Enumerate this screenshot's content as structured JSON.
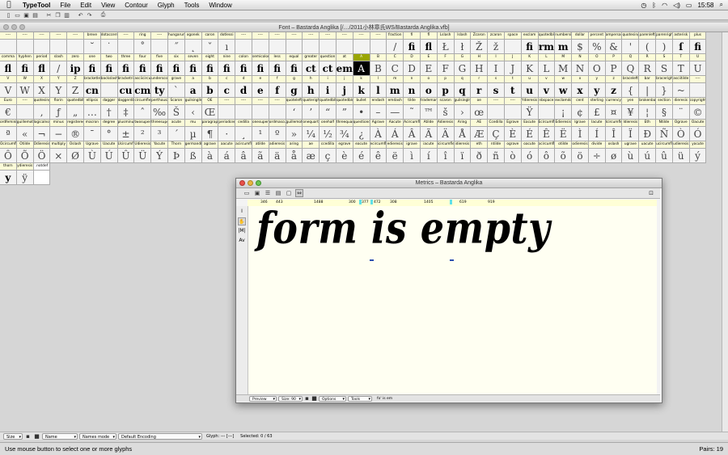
{
  "menubar": {
    "app_name": "TypeTool",
    "items": [
      "File",
      "Edit",
      "View",
      "Contour",
      "Glyph",
      "Tools",
      "Window"
    ],
    "clock": "15:58"
  },
  "font_window": {
    "title": "Font – Bastarda Anglika [/…/2011小林章氏WS/Bastarda Anglika.vfb]",
    "rows": [
      {
        "labels": [
          "----",
          "----",
          "----",
          "----",
          "----",
          "breve",
          "dotaccent",
          "----",
          "ring",
          "----",
          "hungarumlaut",
          "ogonek",
          "caron",
          "dotlessi",
          "----",
          "----",
          "----",
          "----",
          "----",
          "----",
          "----",
          "----",
          "----",
          "fraction",
          "fi",
          "fl",
          "Lslash",
          "lslash",
          "Zcaron",
          "zcaron",
          "space",
          "exclam",
          "quotedbl",
          "numbersign",
          "dollar",
          "percent",
          "ampersand",
          "quotesingle",
          "parenleft",
          "parenright",
          "asterisk",
          "plus"
        ],
        "glyphs": [
          "",
          "",
          "",
          "",
          "",
          "˘",
          "˙",
          "",
          "˚",
          "",
          "˝",
          "˛",
          "ˇ",
          "ı",
          "",
          "",
          "",
          "",
          "",
          "",
          "",
          "",
          "",
          "/",
          "fi",
          "fl",
          "Ł",
          "ł",
          "Ž",
          "ž",
          "",
          "fi",
          "rm",
          "m",
          "$",
          "%",
          "&",
          "'",
          "(",
          ")",
          "ſ",
          "fi"
        ]
      },
      {
        "labels": [
          "comma",
          "hyphen",
          "period",
          "slash",
          "zero",
          "one",
          "two",
          "three",
          "four",
          "five",
          "six",
          "seven",
          "eight",
          "nine",
          "colon",
          "semicolon",
          "less",
          "equal",
          "greater",
          "question",
          "at",
          "A",
          "B",
          "C",
          "D",
          "E",
          "F",
          "G",
          "H",
          "I",
          "J",
          "K",
          "L",
          "M",
          "N",
          "O",
          "P",
          "Q",
          "R",
          "S",
          "T",
          "U"
        ],
        "glyphs": [
          "fl",
          "fi",
          "fl",
          "/",
          "ip",
          "fi",
          "fi",
          "fi",
          "fi",
          "fi",
          "fi",
          "fi",
          "fi",
          "fi",
          "fi",
          "fi",
          "fi",
          "fi",
          "ct",
          "ct",
          "em",
          "A",
          "B",
          "C",
          "D",
          "E",
          "F",
          "G",
          "H",
          "I",
          "J",
          "K",
          "L",
          "M",
          "N",
          "O",
          "P",
          "Q",
          "R",
          "S",
          "T",
          "U"
        ]
      },
      {
        "labels": [
          "V",
          "W",
          "X",
          "Y",
          "Z",
          "bracketleft",
          "backslash",
          "bracketright",
          "asciicircum",
          "underscore",
          "grave",
          "a",
          "b",
          "c",
          "d",
          "e",
          "f",
          "g",
          "h",
          "i",
          "j",
          "k",
          "l",
          "m",
          "n",
          "o",
          "p",
          "q",
          "r",
          "s",
          "t",
          "u",
          "v",
          "w",
          "x",
          "y",
          "z",
          "braceleft",
          "bar",
          "braceright",
          "asciitilde",
          "----"
        ],
        "glyphs": [
          "V",
          "W",
          "X",
          "Y",
          "Z",
          "cn",
          "",
          "cu",
          "cm",
          "ty",
          "`",
          "a",
          "b",
          "c",
          "d",
          "e",
          "f",
          "g",
          "h",
          "i",
          "j",
          "k",
          "l",
          "m",
          "n",
          "o",
          "p",
          "q",
          "r",
          "s",
          "t",
          "u",
          "v",
          "w",
          "x",
          "y",
          "z",
          "{",
          "|",
          "}",
          "~",
          ""
        ]
      },
      {
        "labels": [
          "Euro",
          "----",
          "quotesinglbase",
          "florin",
          "quotedblbase",
          "ellipsis",
          "dagger",
          "daggerdbl",
          "circumflex",
          "perthousand",
          "Scaron",
          "guilsinglleft",
          "OE",
          "----",
          "----",
          "----",
          "----",
          "quoteleft",
          "quoteright",
          "quotedblleft",
          "quotedblright",
          "bullet",
          "endash",
          "emdash",
          "tilde",
          "trademark",
          "scaron",
          "guilsinglright",
          "oe",
          "----",
          "----",
          "Ydieresis",
          "nbspace",
          "exclamdown",
          "cent",
          "sterling",
          "currency",
          "yen",
          "brokenbar",
          "section",
          "dieresis",
          "copyright"
        ],
        "glyphs": [
          "€",
          "",
          "‚",
          "ƒ",
          "„",
          "…",
          "†",
          "‡",
          "ˆ",
          "‰",
          "Š",
          "‹",
          "Œ",
          "",
          "",
          "",
          "",
          "‘",
          "’",
          "“",
          "”",
          "•",
          "–",
          "—",
          "˜",
          "™",
          "š",
          "›",
          "œ",
          "",
          "",
          "Ÿ",
          "",
          "¡",
          "¢",
          "£",
          "¤",
          "¥",
          "¦",
          "§",
          "¨",
          "©"
        ]
      },
      {
        "labels": [
          "ordfeminine",
          "guillemotleft",
          "logicalnot",
          "minus",
          "registered",
          "macron",
          "degree",
          "plusminus",
          "twosuperior",
          "threesuperior",
          "acute",
          "mu",
          "paragraph",
          "periodcentered",
          "cedilla",
          "onesuperior",
          "ordmasculine",
          "guillemotright",
          "onequarter",
          "onehalf",
          "threequarters",
          "questiondown",
          "Agrave",
          "Aacute",
          "Acircumflex",
          "Atilde",
          "Adieresis",
          "Aring",
          "AE",
          "Ccedilla",
          "Egrave",
          "Eacute",
          "Ecircumflex",
          "Edieresis",
          "Igrave",
          "Iacute",
          "Icircumflex",
          "Idieresis",
          "Eth",
          "Ntilde",
          "Ograve",
          "Oacute"
        ],
        "glyphs": [
          "ª",
          "«",
          "¬",
          "−",
          "®",
          "¯",
          "°",
          "±",
          "²",
          "³",
          "´",
          "µ",
          "¶",
          "·",
          "¸",
          "¹",
          "º",
          "»",
          "¼",
          "½",
          "¾",
          "¿",
          "À",
          "Á",
          "Â",
          "Ã",
          "Ä",
          "Å",
          "Æ",
          "Ç",
          "È",
          "É",
          "Ê",
          "Ë",
          "Ì",
          "Í",
          "Î",
          "Ï",
          "Ð",
          "Ñ",
          "Ò",
          "Ó"
        ]
      },
      {
        "labels": [
          "Ocircumflex",
          "Otilde",
          "Odieresis",
          "multiply",
          "Oslash",
          "Ugrave",
          "Uacute",
          "Ucircumflex",
          "Udieresis",
          "Yacute",
          "Thorn",
          "germandbls",
          "agrave",
          "aacute",
          "acircumflex",
          "atilde",
          "adieresis",
          "aring",
          "ae",
          "ccedilla",
          "egrave",
          "eacute",
          "ecircumflex",
          "edieresis",
          "igrave",
          "iacute",
          "icircumflex",
          "idieresis",
          "eth",
          "ntilde",
          "ograve",
          "oacute",
          "ocircumflex",
          "otilde",
          "odieresis",
          "divide",
          "oslash",
          "ugrave",
          "uacute",
          "ucircumflex",
          "udieresis",
          "yacute"
        ],
        "glyphs": [
          "Ô",
          "Õ",
          "Ö",
          "×",
          "Ø",
          "Ù",
          "Ú",
          "Û",
          "Ü",
          "Ý",
          "Þ",
          "ß",
          "à",
          "á",
          "â",
          "ã",
          "ä",
          "å",
          "æ",
          "ç",
          "è",
          "é",
          "ê",
          "ë",
          "ì",
          "í",
          "î",
          "ï",
          "ð",
          "ñ",
          "ò",
          "ó",
          "ô",
          "õ",
          "ö",
          "÷",
          "ø",
          "ù",
          "ú",
          "û",
          "ü",
          "ý"
        ]
      },
      {
        "labels": [
          "thorn",
          "ydieresis",
          ".notdef"
        ],
        "glyphs": [
          "y",
          "ÿ",
          ""
        ]
      }
    ],
    "bottom": {
      "size_label": "Size",
      "name_option": "Name",
      "names_mode": "Names mode",
      "encoding": "Default Encoding",
      "glyph_info": "Glyph: --- [---]",
      "selected": "Selected: 0 / 63"
    }
  },
  "metrics_window": {
    "title": "Metrics – Bastarda Anglika",
    "ruler_values": [
      "346",
      "443",
      "1488",
      "300",
      "377",
      "472",
      "308",
      "1405",
      "619",
      "919"
    ],
    "specimen": "form is empty",
    "bottom": {
      "mode": "Preview",
      "size": "Size: 90",
      "options": "Options",
      "tools": "Tools",
      "text": "fo' is em"
    }
  },
  "status": {
    "message": "Use mouse button to select one or more glyphs",
    "pairs": "Pairs: 19"
  },
  "colors": {
    "label_bg": "#fbfbd8",
    "selected_label": "#9aa600",
    "marker": "#5fe0e8",
    "canvas": "#fffff2"
  }
}
